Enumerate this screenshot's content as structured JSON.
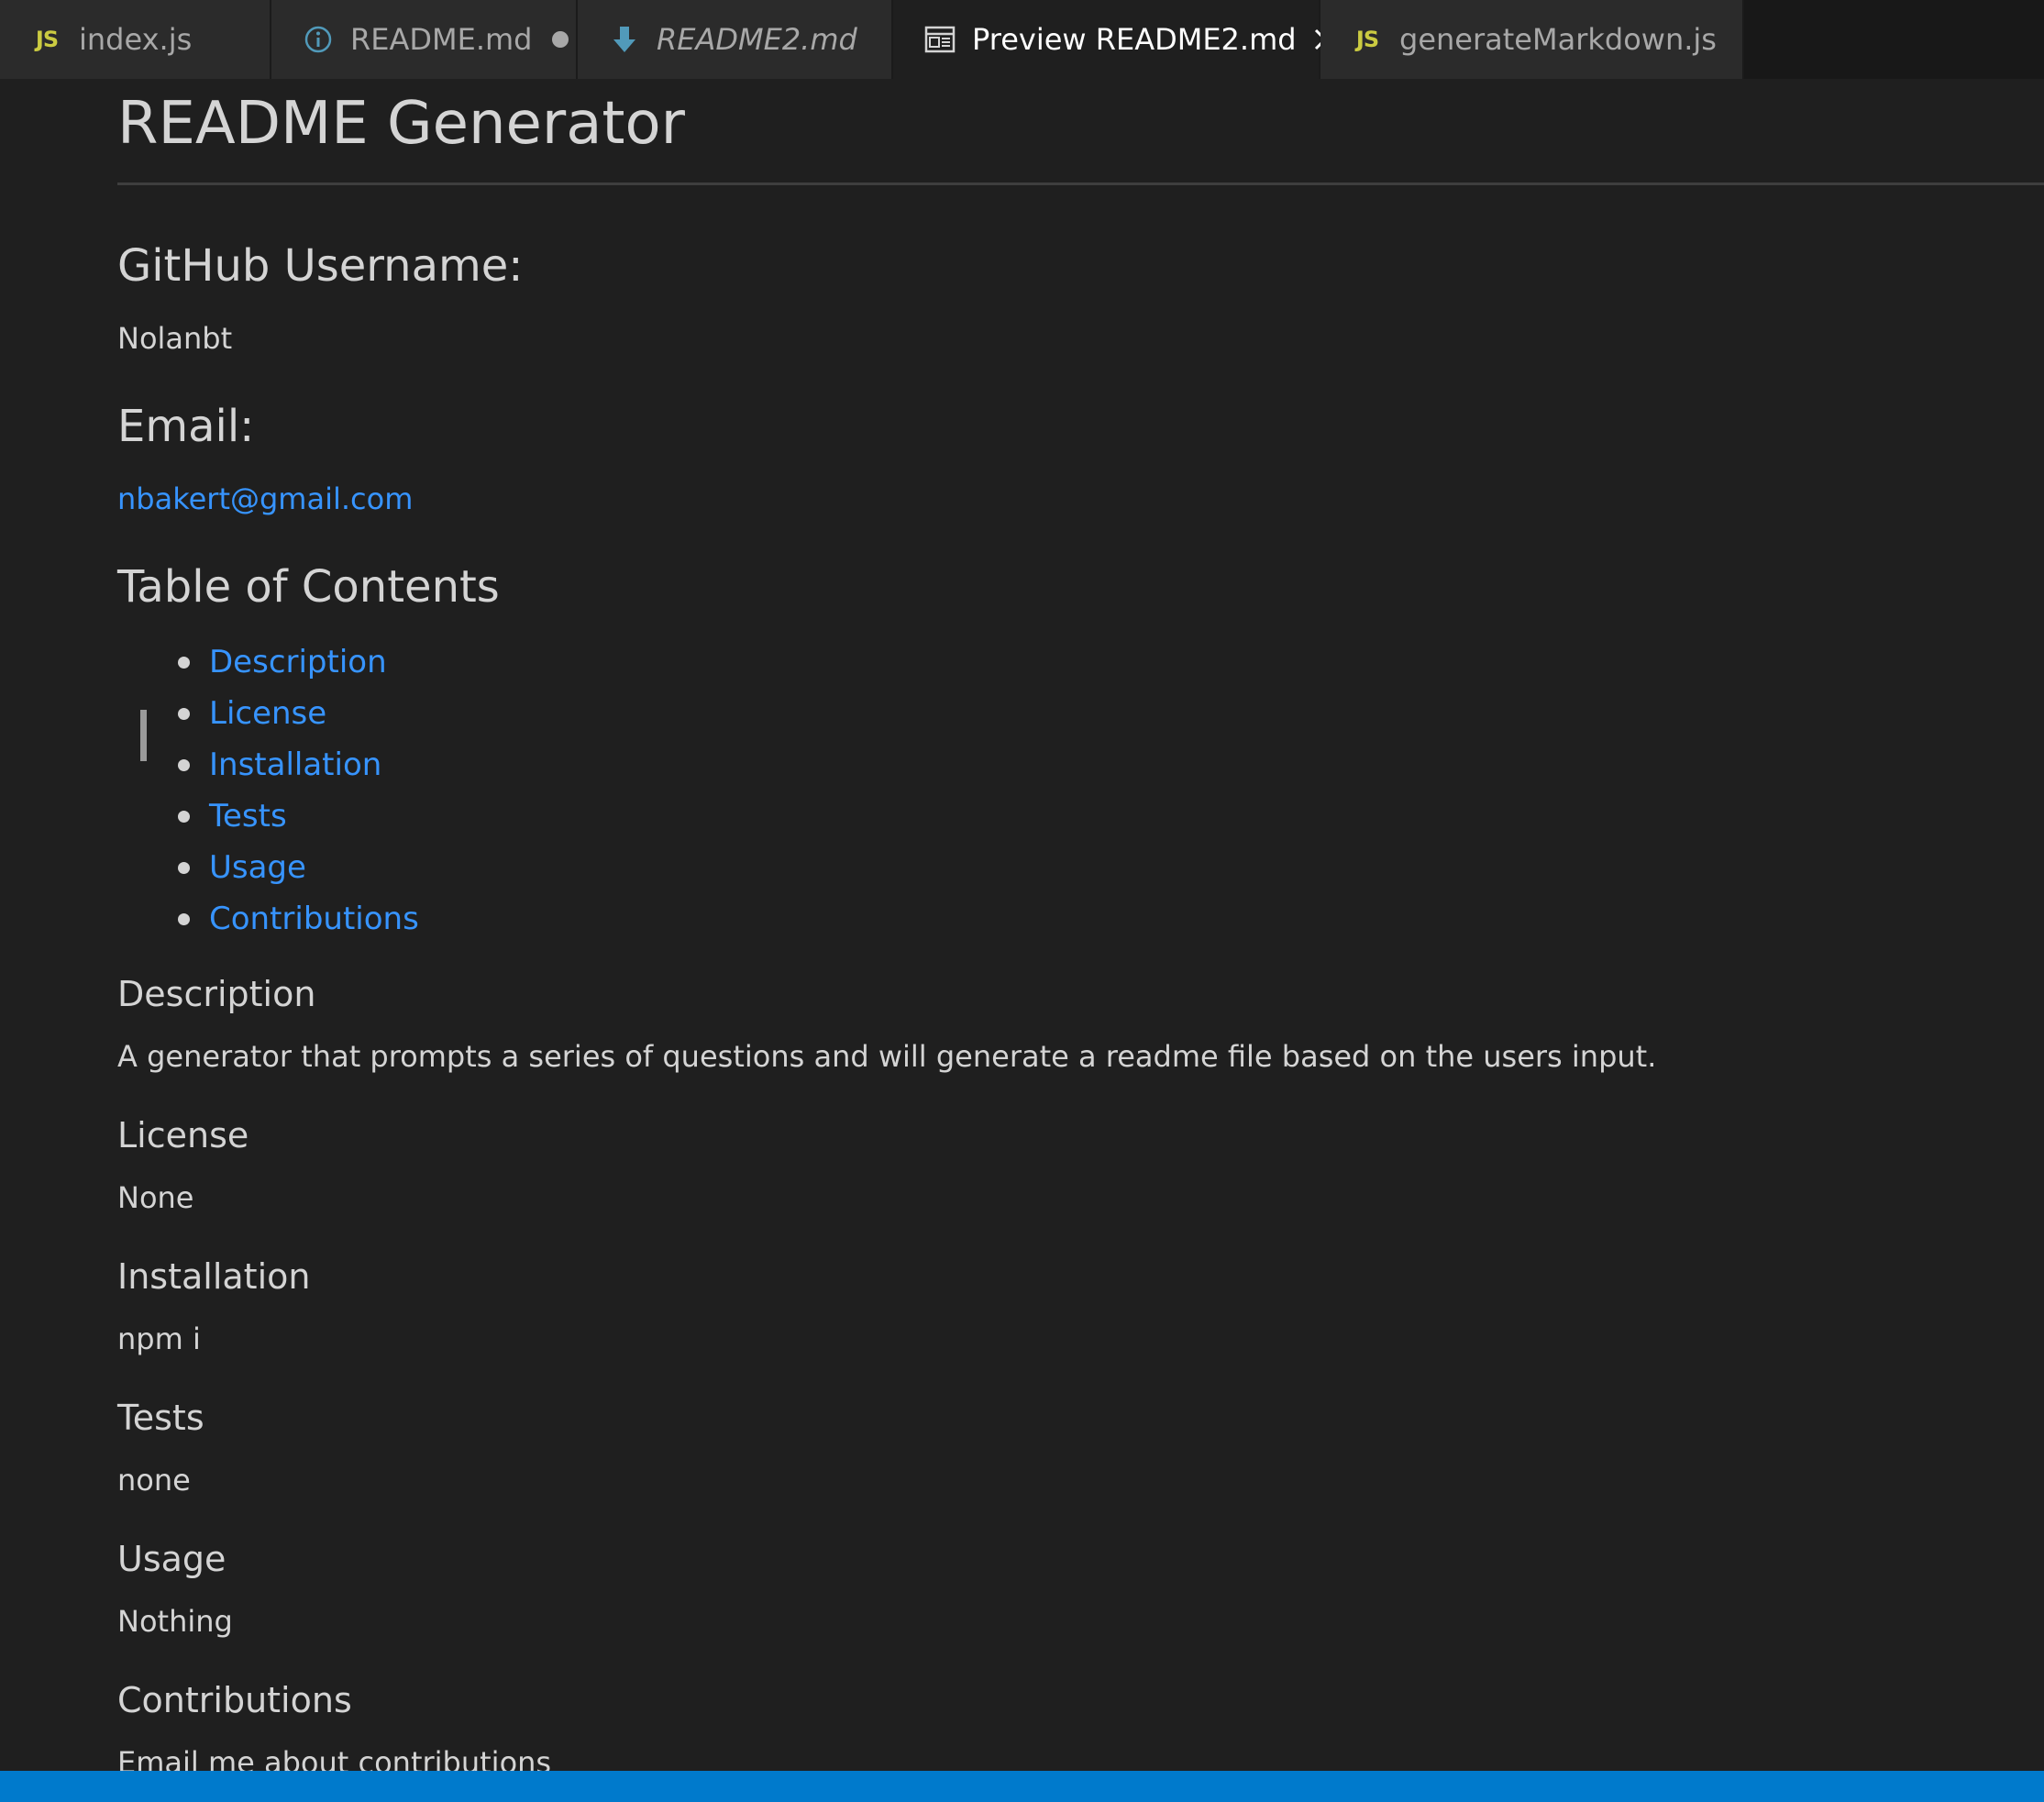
{
  "tabs": [
    {
      "label": "index.js",
      "icon": "js-icon",
      "icon_text": "JS",
      "italic": false,
      "dirty": false,
      "active": false
    },
    {
      "label": "README.md",
      "icon": "info-icon",
      "italic": false,
      "dirty": true,
      "active": false
    },
    {
      "label": "README2.md",
      "icon": "markdown-download-icon",
      "italic": true,
      "dirty": false,
      "active": false
    },
    {
      "label": "Preview README2.md",
      "icon": "preview-icon",
      "italic": false,
      "dirty": false,
      "active": true
    },
    {
      "label": "generateMarkdown.js",
      "icon": "js-icon",
      "icon_text": "JS",
      "italic": false,
      "dirty": false,
      "active": false
    }
  ],
  "document": {
    "title": "README Generator",
    "github_heading": "GitHub Username:",
    "github_username": "Nolanbt",
    "email_heading": "Email:",
    "email": "nbakert@gmail.com",
    "toc_heading": "Table of Contents",
    "toc": [
      "Description",
      "License",
      "Installation",
      "Tests",
      "Usage",
      "Contributions"
    ],
    "sections": [
      {
        "heading": "Description",
        "body": "A generator that prompts a series of questions and will generate a readme file based on the users input."
      },
      {
        "heading": "License",
        "body": "None"
      },
      {
        "heading": "Installation",
        "body": "npm i"
      },
      {
        "heading": "Tests",
        "body": "none"
      },
      {
        "heading": "Usage",
        "body": "Nothing"
      },
      {
        "heading": "Contributions",
        "body": "Email me about contributions"
      }
    ]
  },
  "colors": {
    "background": "#1f1f1f",
    "tab_inactive": "#2b2b2b",
    "link": "#3794ff",
    "js_icon": "#cbcb41",
    "info_icon": "#519aba",
    "statusbar": "#007acc"
  }
}
